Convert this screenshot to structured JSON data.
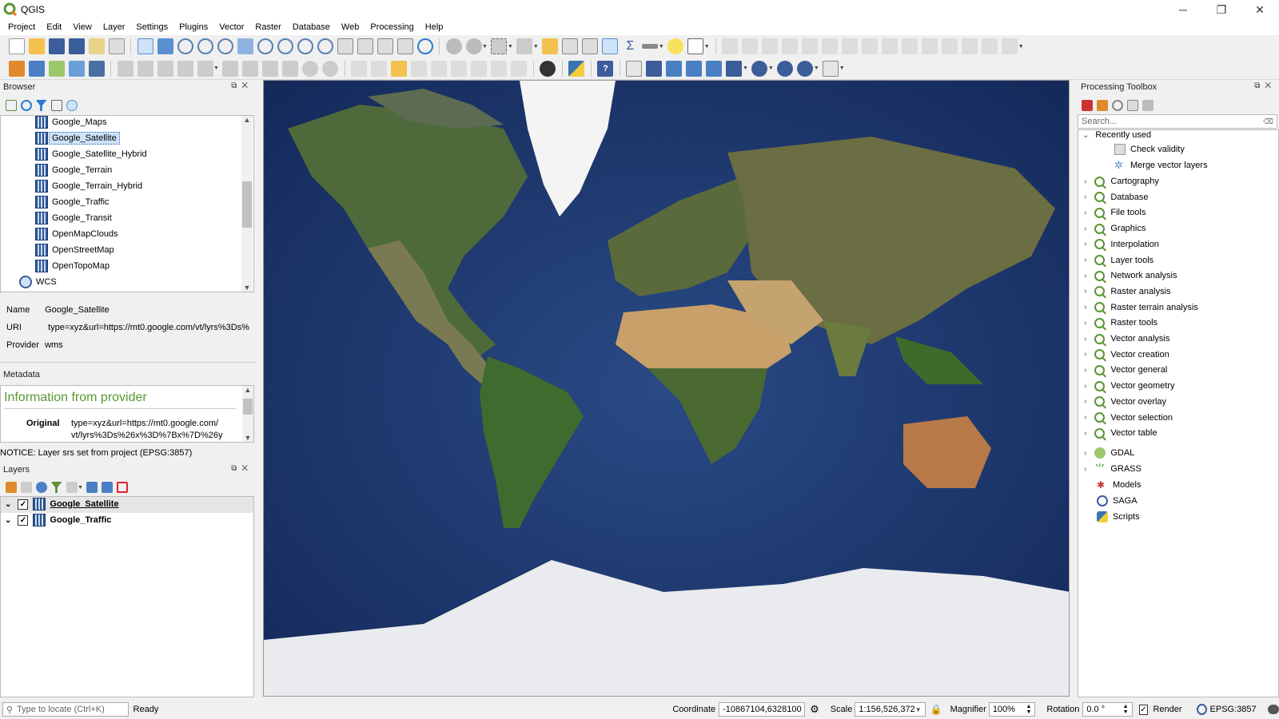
{
  "window": {
    "title": "QGIS",
    "minimize": "─",
    "maximize": "❐",
    "close": "✕"
  },
  "menu": [
    "Project",
    "Edit",
    "View",
    "Layer",
    "Settings",
    "Plugins",
    "Vector",
    "Raster",
    "Database",
    "Web",
    "Processing",
    "Help"
  ],
  "browser": {
    "title": "Browser",
    "items": [
      "Google_Maps",
      "Google_Satellite",
      "Google_Satellite_Hybrid",
      "Google_Terrain",
      "Google_Terrain_Hybrid",
      "Google_Traffic",
      "Google_Transit",
      "OpenMapClouds",
      "OpenStreetMap",
      "OpenTopoMap"
    ],
    "selected_index": 1,
    "wcs_label": "WCS",
    "info": {
      "name_key": "Name",
      "name_val": "Google_Satellite",
      "uri_key": "URI",
      "uri_val": "type=xyz&url=https://mt0.google.com/vt/lyrs%3Ds%",
      "provider_key": "Provider",
      "provider_val": "wms"
    },
    "metadata_label": "Metadata",
    "meta_heading": "Information from provider",
    "meta_original_key": "Original",
    "meta_original_val1": "type=xyz&url=https://mt0.google.com/",
    "meta_original_val2": "vt/lyrs%3Ds%26x%3D%7Bx%7D%26y",
    "notice": "NOTICE: Layer srs set from project (EPSG:3857)"
  },
  "layers": {
    "title": "Layers",
    "items": [
      {
        "label": "Google_Satellite",
        "checked": true,
        "underline": true
      },
      {
        "label": "Google_Traffic",
        "checked": true,
        "underline": false
      }
    ]
  },
  "toolbox": {
    "title": "Processing Toolbox",
    "search_placeholder": "Search...",
    "recent_label": "Recently used",
    "recent": [
      "Check validity",
      "Merge vector layers"
    ],
    "groups": [
      "Cartography",
      "Database",
      "File tools",
      "Graphics",
      "Interpolation",
      "Layer tools",
      "Network analysis",
      "Raster analysis",
      "Raster terrain analysis",
      "Raster tools",
      "Vector analysis",
      "Vector creation",
      "Vector general",
      "Vector geometry",
      "Vector overlay",
      "Vector selection",
      "Vector table"
    ],
    "providers": [
      "GDAL",
      "GRASS",
      "Models",
      "SAGA",
      "Scripts"
    ]
  },
  "status": {
    "locate_placeholder": "Type to locate (Ctrl+K)",
    "ready": "Ready",
    "coordinate_label": "Coordinate",
    "coordinate_val": "-10867104,6328100",
    "scale_label": "Scale",
    "scale_val": "1:156,526,372",
    "magnifier_label": "Magnifier",
    "magnifier_val": "100%",
    "rotation_label": "Rotation",
    "rotation_val": "0.0 °",
    "render_label": "Render",
    "crs": "EPSG:3857"
  }
}
